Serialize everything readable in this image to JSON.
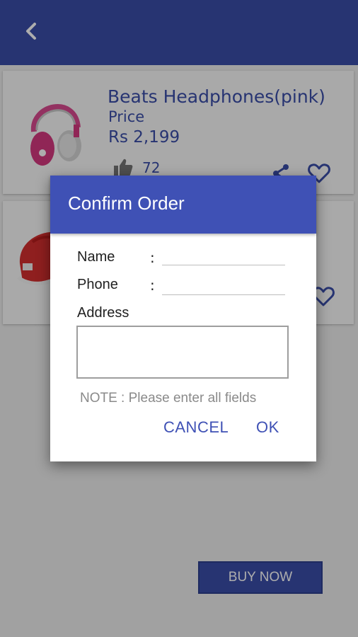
{
  "app": {
    "colors": {
      "primary": "#3a4da8",
      "dialog_header": "#3f51b5",
      "background": "#ededed"
    },
    "back_icon": "chevron-left-icon"
  },
  "products": [
    {
      "title": "Beats Headphones(pink)",
      "price_label": "Price",
      "price": "Rs 2,199",
      "likes": "72",
      "image": "pink-headphones"
    },
    {
      "image": "red-shoes"
    }
  ],
  "buy_now_label": "BUY NOW",
  "dialog": {
    "title": "Confirm Order",
    "name_label": "Name",
    "phone_label": "Phone",
    "address_label": "Address",
    "separator": ":",
    "name_value": "",
    "phone_value": "",
    "address_value": "",
    "note": "NOTE : Please enter all fields",
    "cancel_label": "CANCEL",
    "ok_label": "OK"
  }
}
